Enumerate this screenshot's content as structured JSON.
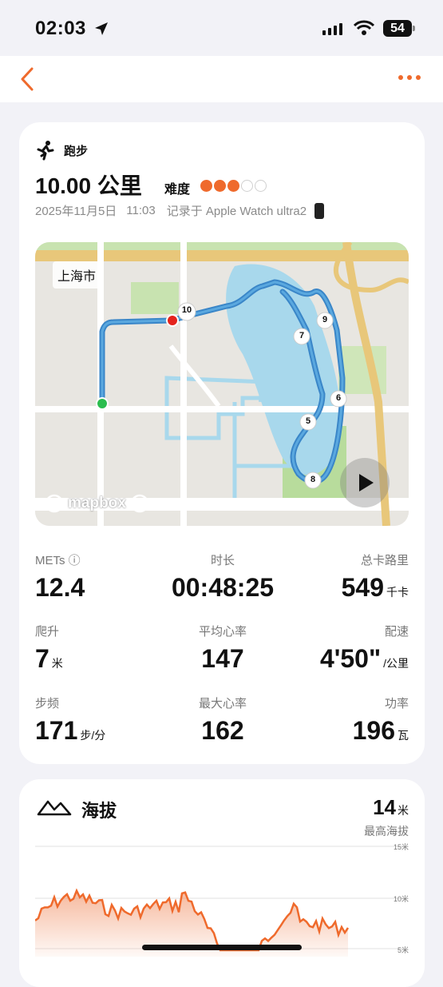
{
  "status": {
    "time": "02:03",
    "battery": "54"
  },
  "workout": {
    "sport_label": "跑步",
    "distance": "10.00 公里",
    "difficulty_label": "难度",
    "difficulty": {
      "level": 3,
      "max": 5
    },
    "date": "2025年11月5日",
    "time": "11:03",
    "recorded_by": "记录于 Apple Watch ultra2"
  },
  "map": {
    "city_label": "上海市",
    "attribution": "mapbox",
    "markers": [
      "10",
      "9",
      "7",
      "6",
      "5",
      "8"
    ]
  },
  "stats": [
    {
      "label": "METs ⓘ",
      "value": "12.4",
      "unit": ""
    },
    {
      "label": "时长",
      "value": "00:48:25",
      "unit": ""
    },
    {
      "label": "总卡路里",
      "value": "549",
      "unit": "千卡"
    },
    {
      "label": "爬升",
      "value": "7",
      "unit": "米"
    },
    {
      "label": "平均心率",
      "value": "147",
      "unit": ""
    },
    {
      "label": "配速",
      "value": "4'50\"",
      "unit": "/公里"
    },
    {
      "label": "步频",
      "value": "171",
      "unit": "步/分"
    },
    {
      "label": "最大心率",
      "value": "162",
      "unit": ""
    },
    {
      "label": "功率",
      "value": "196",
      "unit": "瓦"
    }
  ],
  "altitude": {
    "title": "海拔",
    "max_value": "14",
    "max_unit": "米",
    "max_label": "最高海拔",
    "axis_labels": [
      "15米",
      "10米",
      "5米"
    ]
  },
  "colors": {
    "accent": "#ef6a2c",
    "route": "#3a86c8"
  },
  "icons": [
    "back-chevron-icon",
    "more-dots-icon",
    "running-icon",
    "location-arrow-icon",
    "mountain-icon",
    "play-icon"
  ]
}
